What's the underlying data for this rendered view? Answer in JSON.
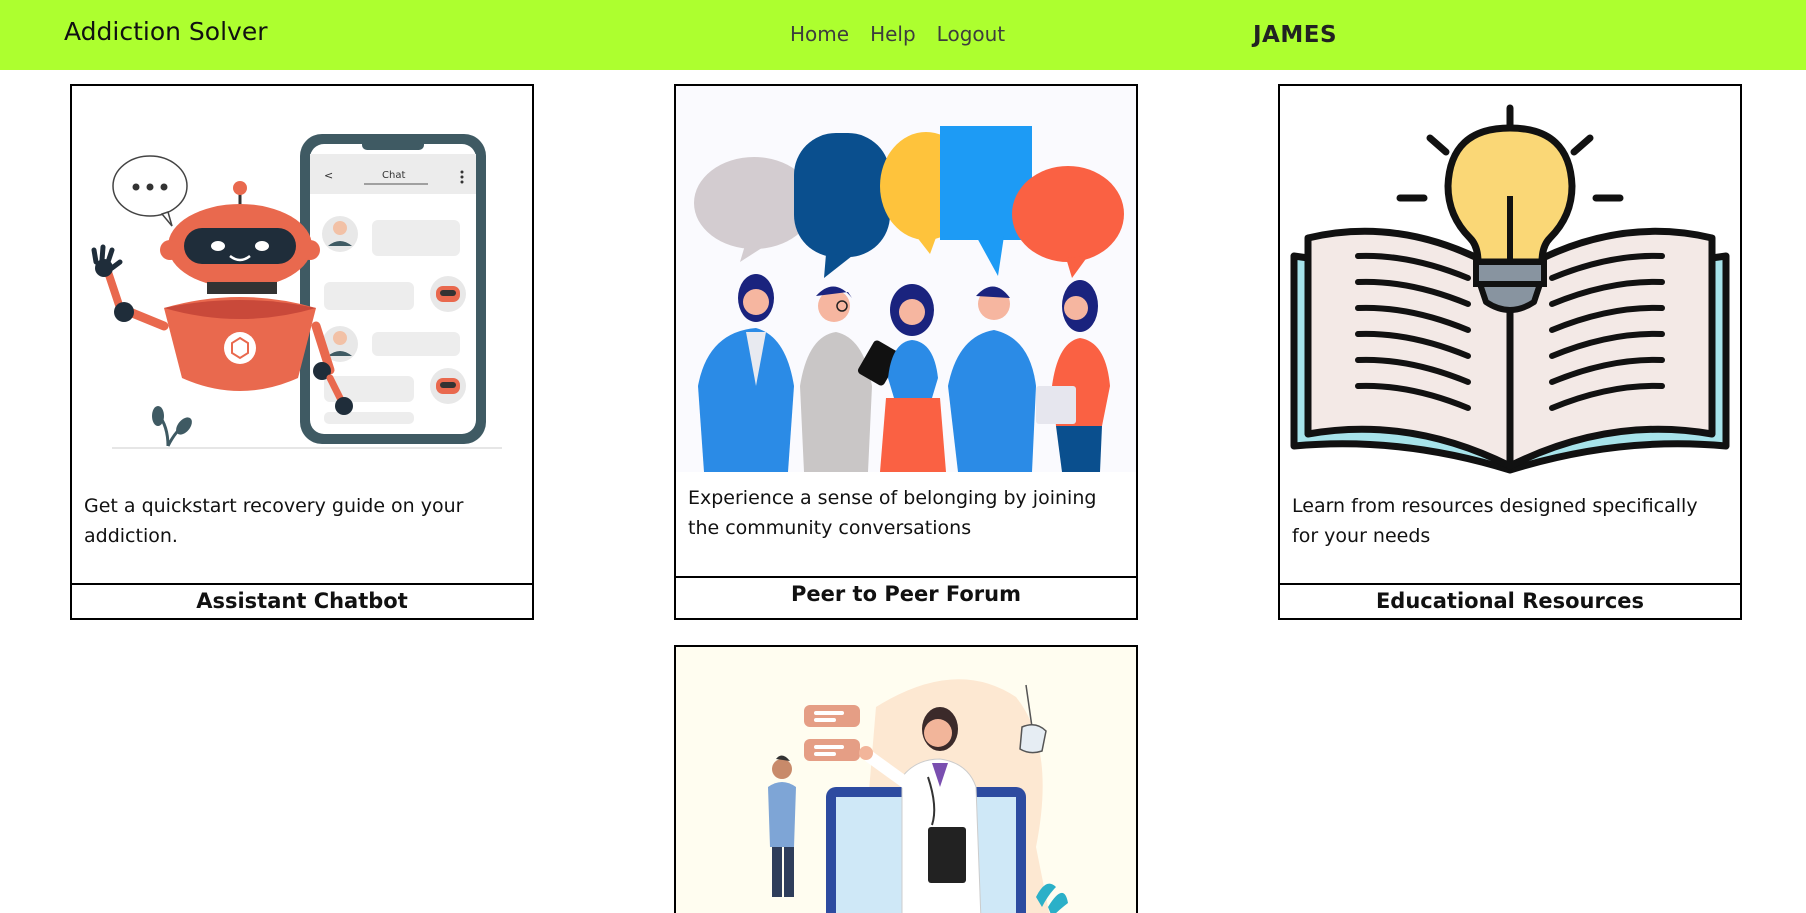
{
  "navbar": {
    "brand": "Addiction Solver",
    "links": [
      "Home",
      "Help",
      "Logout"
    ],
    "user": "JAMES",
    "bg_color": "#adff2f"
  },
  "cards": [
    {
      "title": "Assistant Chatbot",
      "description": "Get a quickstart recovery guide on your addiction.",
      "chat_header": "Chat",
      "illustration": "robot-chatbot-illustration"
    },
    {
      "title": "Peer to Peer Forum",
      "description": "Experience a sense of belonging by joining the community conversations",
      "illustration": "people-speech-bubbles-illustration"
    },
    {
      "title": "Educational Resources",
      "description": "Learn from resources designed specifically for your needs",
      "illustration": "book-lightbulb-illustration"
    },
    {
      "title": "",
      "description": "",
      "illustration": "doctor-consultation-illustration"
    }
  ]
}
